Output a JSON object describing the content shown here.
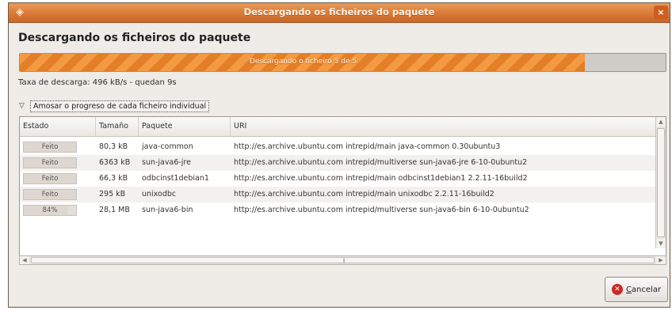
{
  "window": {
    "title": "Descargando os ficheiros do paquete",
    "title_icon": "package-icon",
    "close_icon": "close-icon",
    "close_glyph": "×"
  },
  "heading": "Descargando os ficheiros do paquete",
  "progress": {
    "label": "Descargando o ficheiro 5 de 5",
    "fraction": 0.875,
    "fill_color": "#f0933f"
  },
  "rate_text": "Taxa de descarga: 496 kB/s - quedan 9s",
  "expander": {
    "arrow_icon": "triangle-down-icon",
    "arrow_glyph": "▽",
    "label": "Amosar o progreso de cada ficheiro individual"
  },
  "table": {
    "columns": [
      "Estado",
      "Tamaño",
      "Paquete",
      "URI"
    ],
    "rows": [
      {
        "status": "Feito",
        "status_progress": 1.0,
        "size": "80,3 kB",
        "package": "java-common",
        "uri": "http://es.archive.ubuntu.com intrepid/main java-common 0.30ubuntu3"
      },
      {
        "status": "Feito",
        "status_progress": 1.0,
        "size": "6363 kB",
        "package": "sun-java6-jre",
        "uri": "http://es.archive.ubuntu.com intrepid/multiverse sun-java6-jre 6-10-0ubuntu2"
      },
      {
        "status": "Feito",
        "status_progress": 1.0,
        "size": "66,3 kB",
        "package": "odbcinst1debian1",
        "uri": "http://es.archive.ubuntu.com intrepid/main odbcinst1debian1 2.2.11-16build2"
      },
      {
        "status": "Feito",
        "status_progress": 1.0,
        "size": "295 kB",
        "package": "unixodbc",
        "uri": "http://es.archive.ubuntu.com intrepid/main unixodbc 2.2.11-16build2"
      },
      {
        "status": "84%",
        "status_progress": 0.84,
        "size": "28,1 MB",
        "package": "sun-java6-bin",
        "uri": "http://es.archive.ubuntu.com intrepid/multiverse sun-java6-bin 6-10-0ubuntu2"
      }
    ]
  },
  "scroll": {
    "up_glyph": "▲",
    "down_glyph": "▼",
    "left_glyph": "◀",
    "right_glyph": "▶",
    "grip_glyph": "⦀"
  },
  "cancel": {
    "label": "Cancelar",
    "icon": "cancel-icon",
    "icon_glyph": "✕"
  }
}
